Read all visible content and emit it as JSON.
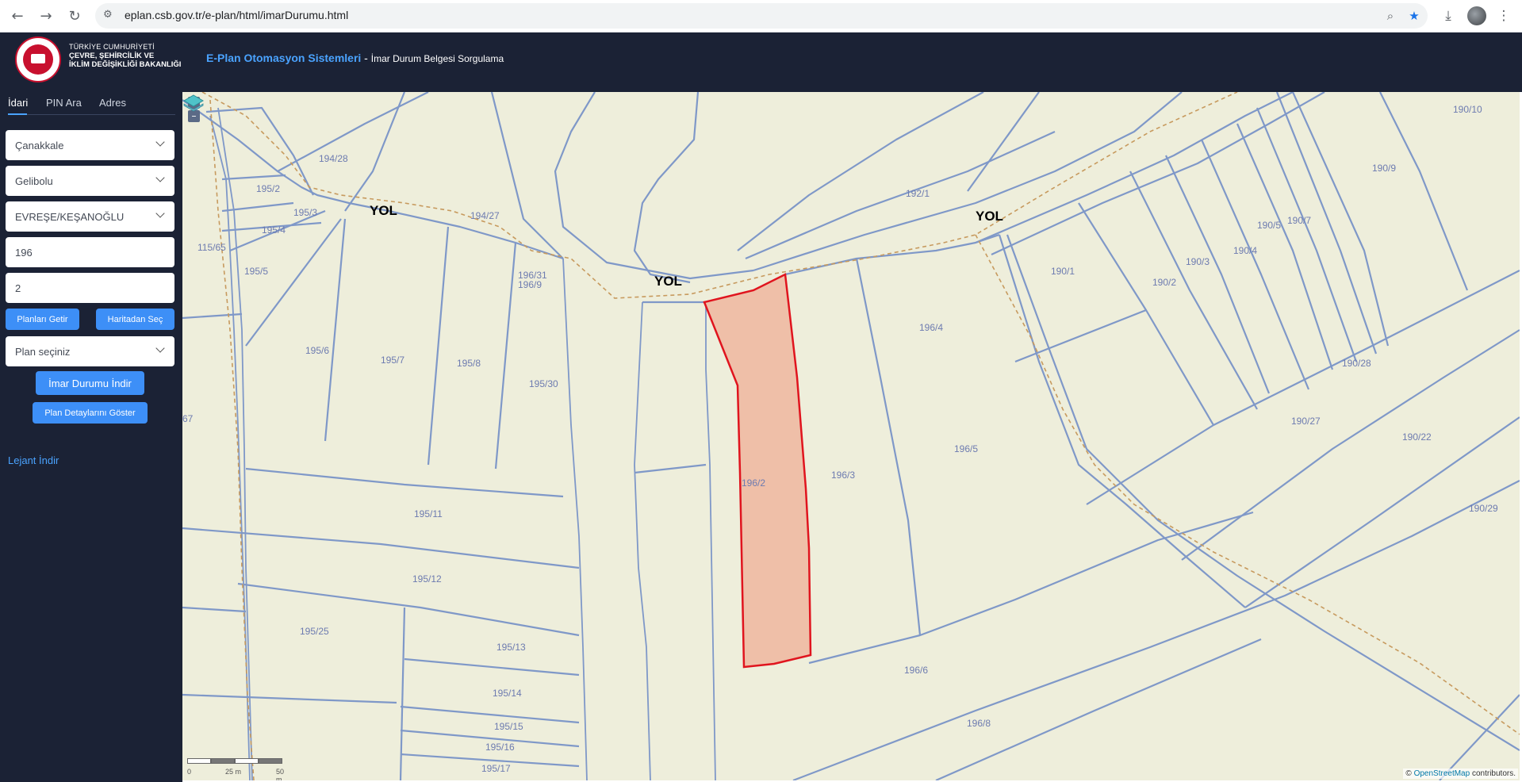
{
  "browser": {
    "url": "eplan.csb.gov.tr/e-plan/html/imarDurumu.html"
  },
  "header": {
    "logo_line1": "TÜRKİYE CUMHURİYETİ",
    "logo_line2": "ÇEVRE, ŞEHİRCİLİK VE",
    "logo_line3": "İKLİM DEĞİŞİKLİĞİ BAKANLIĞI",
    "app_name": "E-Plan Otomasyon Sistemleri",
    "separator": " - ",
    "page_name": "İmar Durum Belgesi Sorgulama"
  },
  "sidebar": {
    "tabs": [
      {
        "label": "İdari"
      },
      {
        "label": "PIN Ara"
      },
      {
        "label": "Adres"
      }
    ],
    "province": "Çanakkale",
    "district": "Gelibolu",
    "neighborhood": "EVREŞE/KEŞANOĞLU",
    "block": "196",
    "parcel": "2",
    "btn_get_plans": "Planları Getir",
    "btn_select_map": "Haritadan Seç",
    "plan_select": "Plan seçiniz",
    "btn_download": "İmar Durumu İndir",
    "btn_details": "Plan Detaylarını Göster",
    "legend_link": "Lejant İndir"
  },
  "map": {
    "zoom_in": "+",
    "zoom_out": "–",
    "attribution_prefix": "© ",
    "attribution_link": "OpenStreetMap",
    "attribution_suffix": " contributors.",
    "scale_0": "0",
    "scale_25": "25 m",
    "scale_50": "50 m",
    "road_labels": [
      "YOL",
      "YOL",
      "YOL"
    ],
    "parcel_labels": [
      "194/28",
      "195/2",
      "195/3",
      "195/4",
      "195/5",
      "195/6",
      "195/7",
      "195/8",
      "195/30",
      "195/11",
      "195/12",
      "195/25",
      "195/13",
      "195/14",
      "195/15",
      "195/16",
      "195/17",
      "194/27",
      "192/1",
      "196/2",
      "196/3",
      "196/4",
      "196/5",
      "196/6",
      "196/8",
      "190/1",
      "190/2",
      "190/3",
      "190/4",
      "190/5",
      "190/7",
      "190/9",
      "190/10",
      "190/27",
      "190/22",
      "190/29",
      "190/28",
      "196/31",
      "196/9",
      "115/65",
      "67"
    ],
    "selected_fill": "#efbfa8",
    "selected_stroke": "#e0141e",
    "parcel_stroke": "#7f98c8",
    "road_dash": "#c79a5e"
  }
}
